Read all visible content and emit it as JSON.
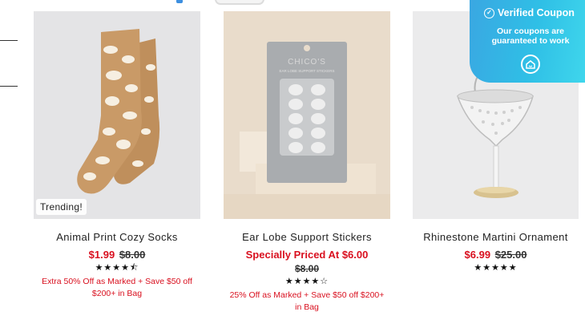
{
  "products": [
    {
      "title": "Animal Print Cozy Socks",
      "price": "$1.99",
      "was_price": "$8.00",
      "rating_stars": "★★★★⯪",
      "promo": "Extra 50% Off as Marked + Save $50 off $200+ in Bag",
      "badge": "Trending!"
    },
    {
      "title": "Ear Lobe Support Stickers",
      "special_price": "Specially Priced At $6.00",
      "was_price": "$8.00",
      "rating_stars": "★★★★☆",
      "promo": "25% Off as Marked + Save $50 off $200+ in Bag",
      "package_brand": "CHICO'S",
      "package_label": "EAR LOBE SUPPORT STICKERS"
    },
    {
      "title": "Rhinestone Martini Ornament",
      "price": "$6.99",
      "was_price": "$25.00",
      "rating_stars": "★★★★★"
    }
  ],
  "coupon_popup": {
    "title": "Verified Coupon",
    "subtitle": "Our coupons are guaranteed to work"
  },
  "colors": {
    "sale_red": "#d9101f",
    "coupon_blue": "#2fbfe6"
  }
}
